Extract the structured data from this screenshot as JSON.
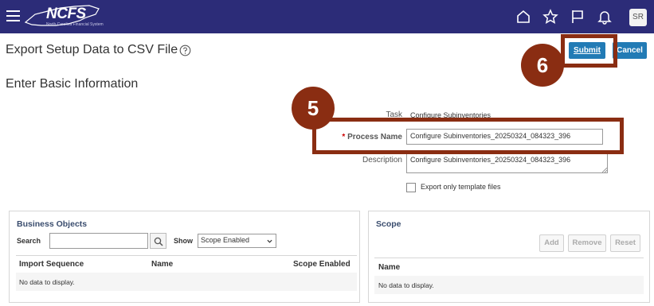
{
  "header": {
    "logo_text": "NCFS",
    "logo_subtext": "North Carolina Financial System",
    "icons": [
      "home-icon",
      "star-icon",
      "flag-icon",
      "bell-icon"
    ],
    "avatar_initials": "SR",
    "bar_color": "#2c2c78"
  },
  "page": {
    "title": "Export Setup Data to CSV File",
    "section_title": "Enter Basic Information"
  },
  "actions": {
    "submit_label": "Submit",
    "cancel_label": "Cancel"
  },
  "form": {
    "task_label": "Task",
    "task_value": "Configure Subinventories",
    "process_name_label": "Process Name",
    "process_name_required_mark": "*",
    "process_name_value": "Configure Subinventories_20250324_084323_396",
    "description_label": "Description",
    "description_value": "Configure Subinventories_20250324_084323_396",
    "export_template_label": "Export only template files",
    "export_template_checked": false
  },
  "callouts": {
    "step_five": "5",
    "step_six": "6",
    "color": "#8a2d12"
  },
  "business_objects": {
    "title": "Business Objects",
    "search_label": "Search",
    "search_value": "",
    "show_label": "Show",
    "show_selected": "Scope Enabled",
    "columns": [
      "Import Sequence",
      "Name",
      "Scope Enabled"
    ],
    "empty_text": "No data to display."
  },
  "scope": {
    "title": "Scope",
    "buttons": [
      "Add",
      "Remove",
      "Reset"
    ],
    "columns": [
      "Name"
    ],
    "empty_text": "No data to display."
  }
}
